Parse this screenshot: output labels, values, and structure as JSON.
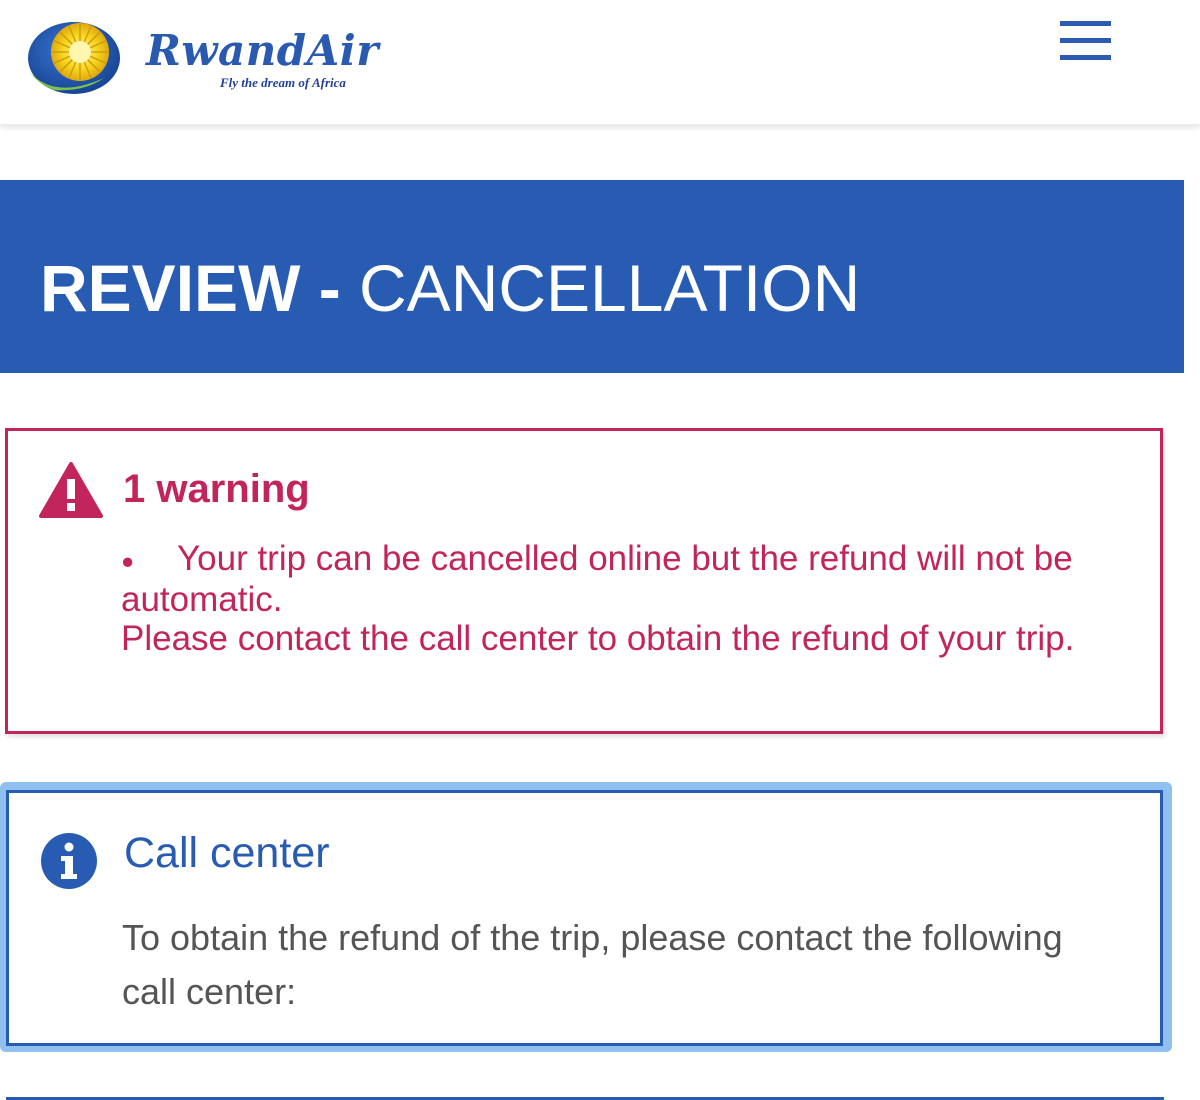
{
  "header": {
    "brand_name": "RwandAir",
    "tagline": "Fly the dream of Africa",
    "logo_icon": "sun-globe-logo-icon",
    "menu_icon": "hamburger-menu-icon"
  },
  "banner": {
    "title_strong": "REVIEW",
    "title_sep": " - ",
    "title_rest": "CANCELLATION"
  },
  "warning": {
    "title": "1 warning",
    "bullet": "●",
    "line1": "Your trip can be cancelled online but the refund will not be automatic.",
    "line2": "Please contact the call center to obtain the refund of your trip.",
    "icon": "warning-triangle-icon"
  },
  "info": {
    "title": "Call center",
    "text": "To obtain the refund of the trip, please contact the following call center:",
    "icon": "info-circle-icon"
  },
  "colors": {
    "brand_blue": "#285cb3",
    "warning_red": "#c2255c",
    "info_glow": "#8fc0ef",
    "body_text": "#555555",
    "logo_yellow": "#f4d21c"
  }
}
